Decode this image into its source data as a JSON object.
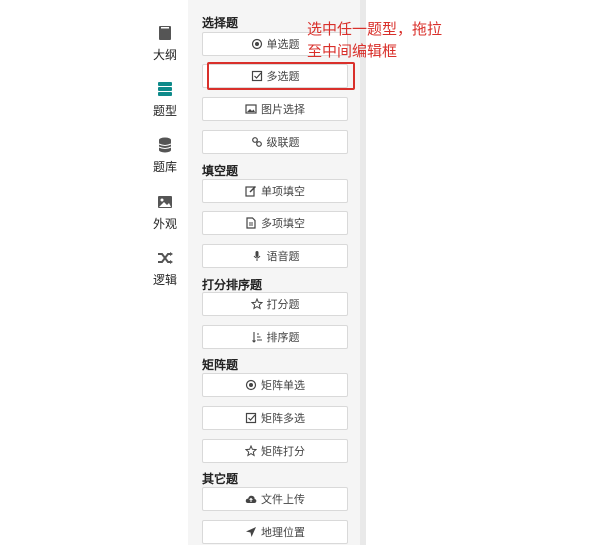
{
  "rail": {
    "items": [
      {
        "label": "大纲",
        "icon": "book-icon"
      },
      {
        "label": "题型",
        "icon": "layers-icon"
      },
      {
        "label": "题库",
        "icon": "database-icon"
      },
      {
        "label": "外观",
        "icon": "image-icon"
      },
      {
        "label": "逻辑",
        "icon": "shuffle-icon"
      }
    ]
  },
  "sections": {
    "choice": {
      "title": "选择题",
      "items": [
        {
          "label": "单选题",
          "icon": "radio-icon"
        },
        {
          "label": "多选题",
          "icon": "checkbox-icon"
        },
        {
          "label": "图片选择",
          "icon": "picture-icon"
        },
        {
          "label": "级联题",
          "icon": "link-icon"
        }
      ]
    },
    "fill": {
      "title": "填空题",
      "items": [
        {
          "label": "单项填空",
          "icon": "edit-icon"
        },
        {
          "label": "多项填空",
          "icon": "document-icon"
        },
        {
          "label": "语音题",
          "icon": "microphone-icon"
        }
      ]
    },
    "rating": {
      "title": "打分排序题",
      "items": [
        {
          "label": "打分题",
          "icon": "star-icon"
        },
        {
          "label": "排序题",
          "icon": "sort-icon"
        }
      ]
    },
    "matrix": {
      "title": "矩阵题",
      "items": [
        {
          "label": "矩阵单选",
          "icon": "radio-icon"
        },
        {
          "label": "矩阵多选",
          "icon": "checkbox-icon"
        },
        {
          "label": "矩阵打分",
          "icon": "star-icon"
        }
      ]
    },
    "other": {
      "title": "其它题",
      "items": [
        {
          "label": "文件上传",
          "icon": "cloud-upload-icon"
        },
        {
          "label": "地理位置",
          "icon": "location-arrow-icon"
        }
      ]
    }
  },
  "annotation": "选中任一题型，拖拉至中间编辑框",
  "colors": {
    "annotation": "#d9302b",
    "panel_bg": "#f5f5f5",
    "rail_icon": "#444444"
  }
}
